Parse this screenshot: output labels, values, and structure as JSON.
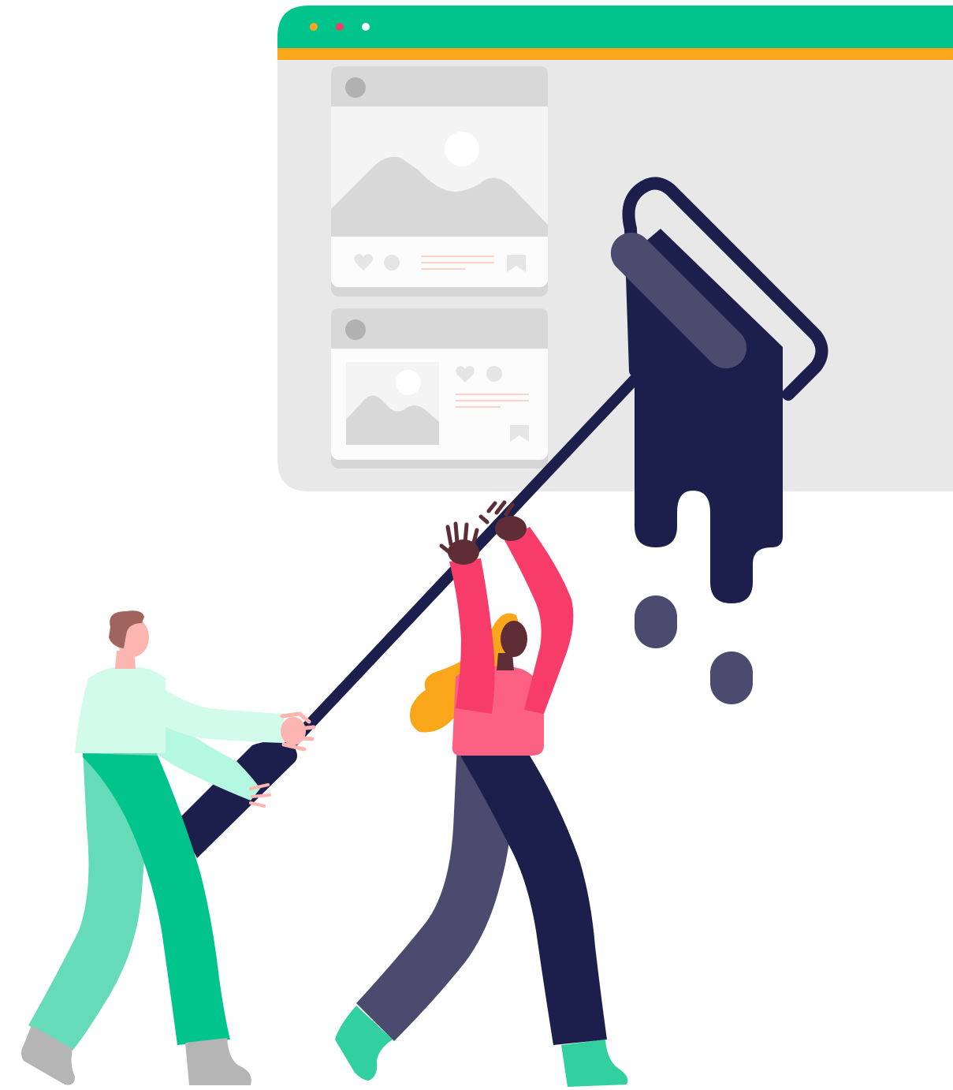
{
  "illustration": {
    "browser_window": {
      "titlebar_color": "#00C48C",
      "accent_bar_color": "#F9A61A",
      "body_color": "#E8E8E8",
      "window_dots": [
        {
          "name": "dot-yellow",
          "color": "#F9A61A"
        },
        {
          "name": "dot-pink",
          "color": "#F73C6A"
        },
        {
          "name": "dot-white",
          "color": "#FFFFFF"
        }
      ]
    },
    "cards": [
      {
        "layout": "image-top",
        "icons": [
          "avatar-icon",
          "image-placeholder-icon",
          "heart-icon",
          "comment-icon",
          "bookmark-icon"
        ]
      },
      {
        "layout": "image-left",
        "icons": [
          "avatar-icon",
          "image-placeholder-icon",
          "heart-icon",
          "comment-icon",
          "bookmark-icon"
        ]
      }
    ],
    "paint_roller": {
      "paint_color": "#1C1E4C",
      "roller_highlight_color": "#4A4B6E"
    },
    "people": [
      {
        "name": "person-left",
        "shirt_color": "#D2FBEC",
        "pants_color": "#00C48C"
      },
      {
        "name": "person-right",
        "shirt_color": "#F73C6A",
        "pants_color": "#1C1E4C",
        "hair_color": "#F9A61A"
      }
    ]
  }
}
